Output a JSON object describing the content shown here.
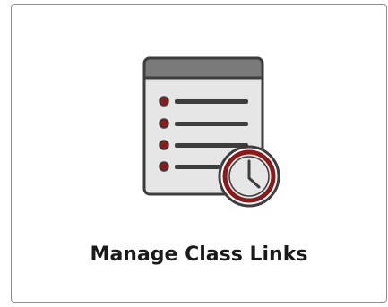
{
  "tile": {
    "label": "Manage Class Links",
    "icon": "class-links-schedule-icon"
  },
  "colors": {
    "border": "#8f8f8f",
    "list_header": "#7a7a7a",
    "list_body": "#e6e6e6",
    "outline": "#3d3d3d",
    "bullet": "#8b1a1a",
    "clock_ring": "#8b1a1a",
    "clock_face": "#e6e6e6",
    "label_text": "#1a1a1a"
  }
}
